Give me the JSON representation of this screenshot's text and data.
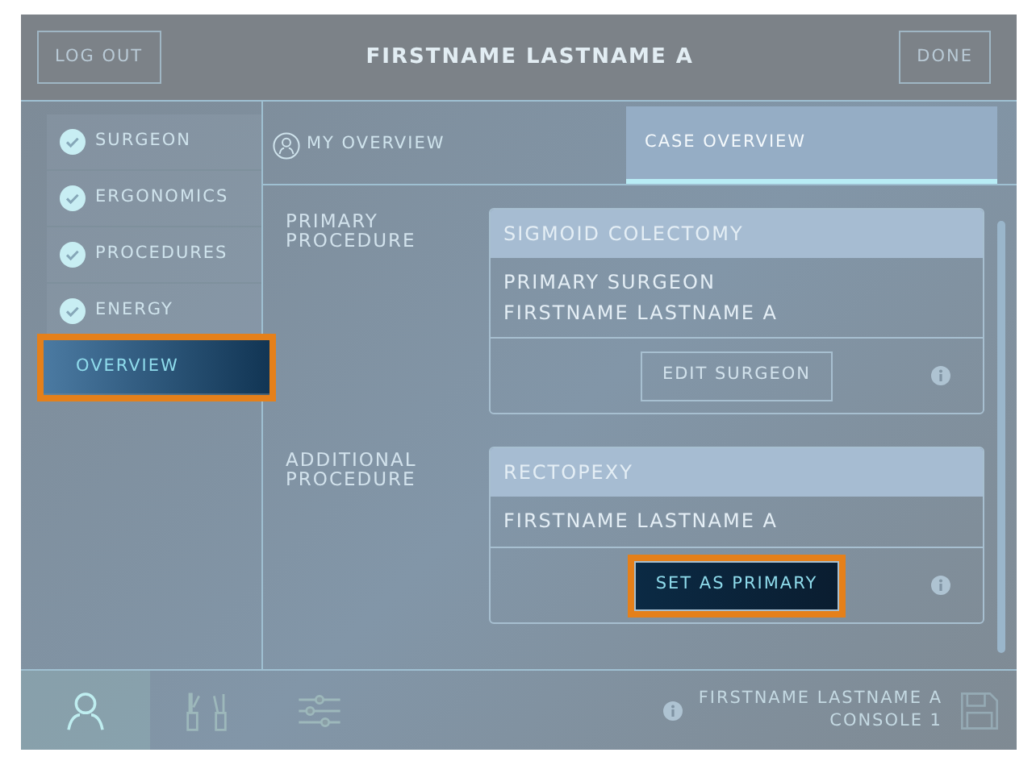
{
  "header": {
    "logout": "LOG OUT",
    "title": "FIRSTNAME LASTNAME A",
    "done": "DONE"
  },
  "sidebar": {
    "items": [
      {
        "label": "SURGEON",
        "checked": true,
        "selected": false,
        "highlighted": false
      },
      {
        "label": "ERGONOMICS",
        "checked": true,
        "selected": false,
        "highlighted": false
      },
      {
        "label": "PROCEDURES",
        "checked": true,
        "selected": false,
        "highlighted": false
      },
      {
        "label": "ENERGY",
        "checked": true,
        "selected": false,
        "highlighted": false
      },
      {
        "label": "OVERVIEW",
        "checked": false,
        "selected": true,
        "highlighted": true
      }
    ]
  },
  "tabs": [
    {
      "label": "MY OVERVIEW",
      "selected": false,
      "kind": "person"
    },
    {
      "label": "CASE OVERVIEW",
      "selected": true,
      "kind": "plain"
    }
  ],
  "procedures": [
    {
      "label": "PRIMARY PROCEDURE",
      "name": "SIGMOID COLECTOMY",
      "details": [
        "PRIMARY SURGEON",
        "FIRSTNAME LASTNAME A"
      ],
      "button": {
        "label": "EDIT SURGEON",
        "highlighted": false
      }
    },
    {
      "label": "ADDITIONAL PROCEDURE",
      "name": "RECTOPEXY",
      "details": [
        "FIRSTNAME LASTNAME A"
      ],
      "button": {
        "label": "SET AS PRIMARY",
        "highlighted": true
      }
    }
  ],
  "footer": {
    "tools": [
      {
        "kind": "person",
        "selected": true
      },
      {
        "kind": "instruments",
        "selected": false
      },
      {
        "kind": "sliders",
        "selected": false
      }
    ],
    "user": "FIRSTNAME LASTNAME A",
    "console": "CONSOLE 1"
  }
}
